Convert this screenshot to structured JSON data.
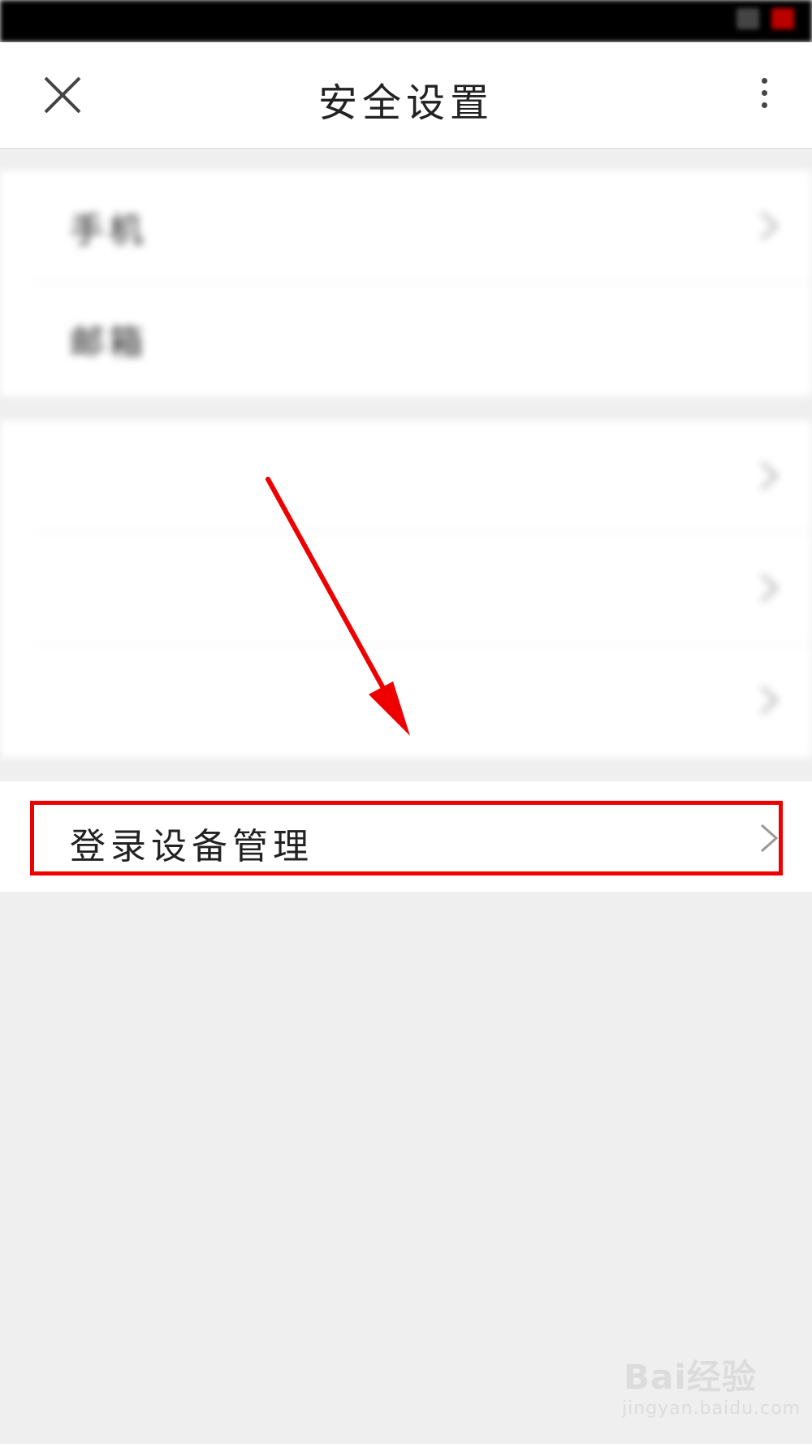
{
  "status_bar": {
    "carrier": "",
    "time": ""
  },
  "header": {
    "title": "安全设置",
    "close_icon": "close-icon",
    "more_icon": "more-vertical-icon"
  },
  "groups": [
    {
      "items": [
        {
          "label": "手机",
          "value": "",
          "chevron": true
        },
        {
          "label": "邮箱",
          "value": "",
          "chevron": false
        }
      ]
    },
    {
      "items": [
        {
          "label": "",
          "value": "",
          "chevron": true
        },
        {
          "label": "",
          "value": "",
          "chevron": true
        },
        {
          "label": "",
          "value": "",
          "chevron": true
        }
      ]
    },
    {
      "items": [
        {
          "label": "登录设备管理",
          "value": "",
          "chevron": true
        }
      ]
    }
  ],
  "annotation": {
    "color": "#ee0000",
    "target": "登录设备管理"
  },
  "watermark": {
    "brand": "Bai经验",
    "url": "jingyan.baidu.com"
  },
  "colors": {
    "background": "#efefef",
    "card": "#ffffff",
    "highlight": "#ee0000"
  }
}
